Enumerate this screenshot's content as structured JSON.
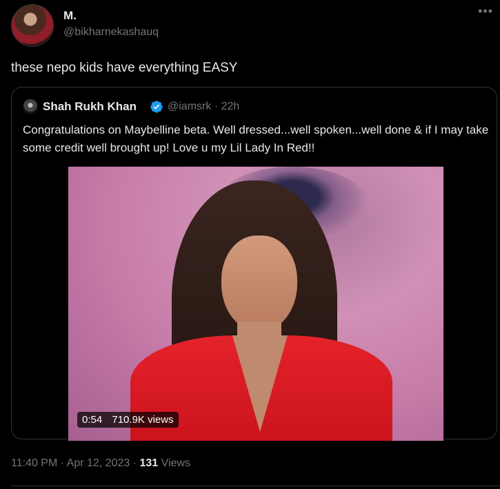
{
  "tweet": {
    "author": {
      "name": "M.",
      "handle": "@bikharnekashauq"
    },
    "more_icon": "•••",
    "text": "these nepo kids have everything EASY",
    "time": "11:40 PM",
    "separator": "·",
    "date": "Apr 12, 2023",
    "views_count": "131",
    "views_label": "Views"
  },
  "quoted_tweet": {
    "author": {
      "name": "Shah Rukh Khan",
      "handle": "@iamsrk",
      "verified": true
    },
    "separator": "·",
    "age": "22h",
    "text": "Congratulations on Maybelline beta. Well dressed...well spoken...well done & if I may take some credit well brought up! Love u my Lil Lady In Red!!",
    "video": {
      "duration": "0:54",
      "views": "710.9K views"
    }
  },
  "colors": {
    "background": "#000000",
    "text": "#e7e9ea",
    "muted": "#71767b",
    "verified": "#1d9bf0",
    "border": "#2f3336"
  },
  "icons": {
    "verified": "verified-badge-icon",
    "more": "more-options-icon"
  }
}
